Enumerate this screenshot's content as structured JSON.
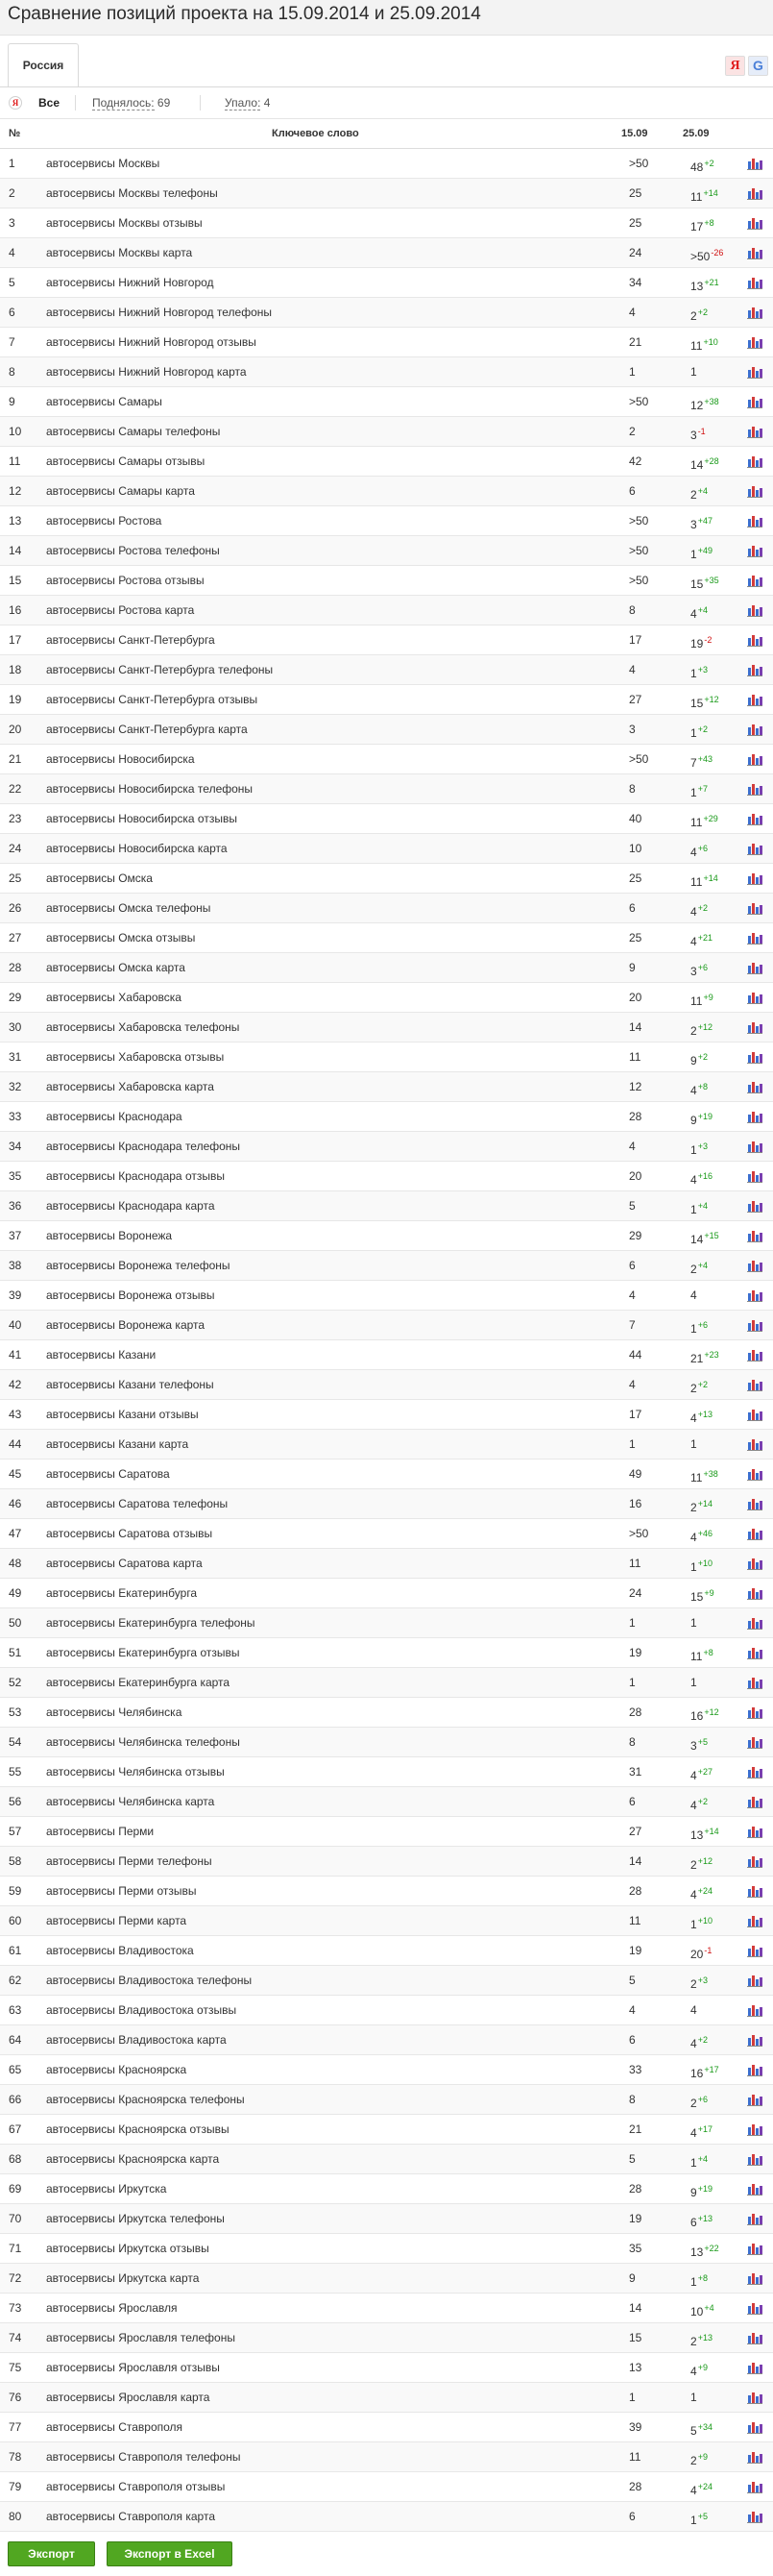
{
  "page": {
    "title": "Сравнение позиций проекта на 15.09.2014 и 25.09.2014"
  },
  "tabs": [
    {
      "label": "Россия"
    }
  ],
  "engines": {
    "yandex": "Я",
    "google": "G"
  },
  "filters": {
    "all": "Все",
    "up_label": "Поднялось:",
    "up_count": "69",
    "down_label": "Упало:",
    "down_count": "4"
  },
  "table": {
    "headers": {
      "no": "№",
      "keyword": "Ключевое слово",
      "date1": "15.09",
      "date2": "25.09"
    },
    "rows": [
      {
        "no": "1",
        "keyword": "автосервисы Москвы",
        "d1": ">50",
        "d2": "48",
        "change": "+2"
      },
      {
        "no": "2",
        "keyword": "автосервисы Москвы телефоны",
        "d1": "25",
        "d2": "11",
        "change": "+14"
      },
      {
        "no": "3",
        "keyword": "автосервисы Москвы отзывы",
        "d1": "25",
        "d2": "17",
        "change": "+8"
      },
      {
        "no": "4",
        "keyword": "автосервисы Москвы карта",
        "d1": "24",
        "d2": ">50",
        "change": "-26"
      },
      {
        "no": "5",
        "keyword": "автосервисы Нижний Новгород",
        "d1": "34",
        "d2": "13",
        "change": "+21"
      },
      {
        "no": "6",
        "keyword": "автосервисы Нижний Новгород телефоны",
        "d1": "4",
        "d2": "2",
        "change": "+2"
      },
      {
        "no": "7",
        "keyword": "автосервисы Нижний Новгород отзывы",
        "d1": "21",
        "d2": "11",
        "change": "+10"
      },
      {
        "no": "8",
        "keyword": "автосервисы Нижний Новгород карта",
        "d1": "1",
        "d2": "1",
        "change": ""
      },
      {
        "no": "9",
        "keyword": "автосервисы Самары",
        "d1": ">50",
        "d2": "12",
        "change": "+38"
      },
      {
        "no": "10",
        "keyword": "автосервисы Самары телефоны",
        "d1": "2",
        "d2": "3",
        "change": "-1"
      },
      {
        "no": "11",
        "keyword": "автосервисы Самары отзывы",
        "d1": "42",
        "d2": "14",
        "change": "+28"
      },
      {
        "no": "12",
        "keyword": "автосервисы Самары карта",
        "d1": "6",
        "d2": "2",
        "change": "+4"
      },
      {
        "no": "13",
        "keyword": "автосервисы Ростова",
        "d1": ">50",
        "d2": "3",
        "change": "+47"
      },
      {
        "no": "14",
        "keyword": "автосервисы Ростова телефоны",
        "d1": ">50",
        "d2": "1",
        "change": "+49"
      },
      {
        "no": "15",
        "keyword": "автосервисы Ростова отзывы",
        "d1": ">50",
        "d2": "15",
        "change": "+35"
      },
      {
        "no": "16",
        "keyword": "автосервисы Ростова карта",
        "d1": "8",
        "d2": "4",
        "change": "+4"
      },
      {
        "no": "17",
        "keyword": "автосервисы Санкт-Петербурга",
        "d1": "17",
        "d2": "19",
        "change": "-2"
      },
      {
        "no": "18",
        "keyword": "автосервисы Санкт-Петербурга телефоны",
        "d1": "4",
        "d2": "1",
        "change": "+3"
      },
      {
        "no": "19",
        "keyword": "автосервисы Санкт-Петербурга отзывы",
        "d1": "27",
        "d2": "15",
        "change": "+12"
      },
      {
        "no": "20",
        "keyword": "автосервисы Санкт-Петербурга карта",
        "d1": "3",
        "d2": "1",
        "change": "+2"
      },
      {
        "no": "21",
        "keyword": "автосервисы Новосибирска",
        "d1": ">50",
        "d2": "7",
        "change": "+43"
      },
      {
        "no": "22",
        "keyword": "автосервисы Новосибирска телефоны",
        "d1": "8",
        "d2": "1",
        "change": "+7"
      },
      {
        "no": "23",
        "keyword": "автосервисы Новосибирска отзывы",
        "d1": "40",
        "d2": "11",
        "change": "+29"
      },
      {
        "no": "24",
        "keyword": "автосервисы Новосибирска карта",
        "d1": "10",
        "d2": "4",
        "change": "+6"
      },
      {
        "no": "25",
        "keyword": "автосервисы Омска",
        "d1": "25",
        "d2": "11",
        "change": "+14"
      },
      {
        "no": "26",
        "keyword": "автосервисы Омска телефоны",
        "d1": "6",
        "d2": "4",
        "change": "+2"
      },
      {
        "no": "27",
        "keyword": "автосервисы Омска отзывы",
        "d1": "25",
        "d2": "4",
        "change": "+21"
      },
      {
        "no": "28",
        "keyword": "автосервисы Омска карта",
        "d1": "9",
        "d2": "3",
        "change": "+6"
      },
      {
        "no": "29",
        "keyword": "автосервисы Хабаровска",
        "d1": "20",
        "d2": "11",
        "change": "+9"
      },
      {
        "no": "30",
        "keyword": "автосервисы Хабаровска телефоны",
        "d1": "14",
        "d2": "2",
        "change": "+12"
      },
      {
        "no": "31",
        "keyword": "автосервисы Хабаровска отзывы",
        "d1": "11",
        "d2": "9",
        "change": "+2"
      },
      {
        "no": "32",
        "keyword": "автосервисы Хабаровска карта",
        "d1": "12",
        "d2": "4",
        "change": "+8"
      },
      {
        "no": "33",
        "keyword": "автосервисы Краснодара",
        "d1": "28",
        "d2": "9",
        "change": "+19"
      },
      {
        "no": "34",
        "keyword": "автосервисы Краснодара телефоны",
        "d1": "4",
        "d2": "1",
        "change": "+3"
      },
      {
        "no": "35",
        "keyword": "автосервисы Краснодара отзывы",
        "d1": "20",
        "d2": "4",
        "change": "+16"
      },
      {
        "no": "36",
        "keyword": "автосервисы Краснодара карта",
        "d1": "5",
        "d2": "1",
        "change": "+4"
      },
      {
        "no": "37",
        "keyword": "автосервисы Воронежа",
        "d1": "29",
        "d2": "14",
        "change": "+15"
      },
      {
        "no": "38",
        "keyword": "автосервисы Воронежа телефоны",
        "d1": "6",
        "d2": "2",
        "change": "+4"
      },
      {
        "no": "39",
        "keyword": "автосервисы Воронежа отзывы",
        "d1": "4",
        "d2": "4",
        "change": ""
      },
      {
        "no": "40",
        "keyword": "автосервисы Воронежа карта",
        "d1": "7",
        "d2": "1",
        "change": "+6"
      },
      {
        "no": "41",
        "keyword": "автосервисы Казани",
        "d1": "44",
        "d2": "21",
        "change": "+23"
      },
      {
        "no": "42",
        "keyword": "автосервисы Казани телефоны",
        "d1": "4",
        "d2": "2",
        "change": "+2"
      },
      {
        "no": "43",
        "keyword": "автосервисы Казани отзывы",
        "d1": "17",
        "d2": "4",
        "change": "+13"
      },
      {
        "no": "44",
        "keyword": "автосервисы Казани карта",
        "d1": "1",
        "d2": "1",
        "change": ""
      },
      {
        "no": "45",
        "keyword": "автосервисы Саратова",
        "d1": "49",
        "d2": "11",
        "change": "+38"
      },
      {
        "no": "46",
        "keyword": "автосервисы Саратова телефоны",
        "d1": "16",
        "d2": "2",
        "change": "+14"
      },
      {
        "no": "47",
        "keyword": "автосервисы Саратова отзывы",
        "d1": ">50",
        "d2": "4",
        "change": "+46"
      },
      {
        "no": "48",
        "keyword": "автосервисы Саратова карта",
        "d1": "11",
        "d2": "1",
        "change": "+10"
      },
      {
        "no": "49",
        "keyword": "автосервисы Екатеринбурга",
        "d1": "24",
        "d2": "15",
        "change": "+9"
      },
      {
        "no": "50",
        "keyword": "автосервисы Екатеринбурга телефоны",
        "d1": "1",
        "d2": "1",
        "change": ""
      },
      {
        "no": "51",
        "keyword": "автосервисы Екатеринбурга отзывы",
        "d1": "19",
        "d2": "11",
        "change": "+8"
      },
      {
        "no": "52",
        "keyword": "автосервисы Екатеринбурга карта",
        "d1": "1",
        "d2": "1",
        "change": ""
      },
      {
        "no": "53",
        "keyword": "автосервисы Челябинска",
        "d1": "28",
        "d2": "16",
        "change": "+12"
      },
      {
        "no": "54",
        "keyword": "автосервисы Челябинска телефоны",
        "d1": "8",
        "d2": "3",
        "change": "+5"
      },
      {
        "no": "55",
        "keyword": "автосервисы Челябинска отзывы",
        "d1": "31",
        "d2": "4",
        "change": "+27"
      },
      {
        "no": "56",
        "keyword": "автосервисы Челябинска карта",
        "d1": "6",
        "d2": "4",
        "change": "+2"
      },
      {
        "no": "57",
        "keyword": "автосервисы Перми",
        "d1": "27",
        "d2": "13",
        "change": "+14"
      },
      {
        "no": "58",
        "keyword": "автосервисы Перми телефоны",
        "d1": "14",
        "d2": "2",
        "change": "+12"
      },
      {
        "no": "59",
        "keyword": "автосервисы Перми отзывы",
        "d1": "28",
        "d2": "4",
        "change": "+24"
      },
      {
        "no": "60",
        "keyword": "автосервисы Перми карта",
        "d1": "11",
        "d2": "1",
        "change": "+10"
      },
      {
        "no": "61",
        "keyword": "автосервисы Владивостока",
        "d1": "19",
        "d2": "20",
        "change": "-1"
      },
      {
        "no": "62",
        "keyword": "автосервисы Владивостока телефоны",
        "d1": "5",
        "d2": "2",
        "change": "+3"
      },
      {
        "no": "63",
        "keyword": "автосервисы Владивостока отзывы",
        "d1": "4",
        "d2": "4",
        "change": ""
      },
      {
        "no": "64",
        "keyword": "автосервисы Владивостока карта",
        "d1": "6",
        "d2": "4",
        "change": "+2"
      },
      {
        "no": "65",
        "keyword": "автосервисы Красноярска",
        "d1": "33",
        "d2": "16",
        "change": "+17"
      },
      {
        "no": "66",
        "keyword": "автосервисы Красноярска телефоны",
        "d1": "8",
        "d2": "2",
        "change": "+6"
      },
      {
        "no": "67",
        "keyword": "автосервисы Красноярска отзывы",
        "d1": "21",
        "d2": "4",
        "change": "+17"
      },
      {
        "no": "68",
        "keyword": "автосервисы Красноярска карта",
        "d1": "5",
        "d2": "1",
        "change": "+4"
      },
      {
        "no": "69",
        "keyword": "автосервисы Иркутска",
        "d1": "28",
        "d2": "9",
        "change": "+19"
      },
      {
        "no": "70",
        "keyword": "автосервисы Иркутска телефоны",
        "d1": "19",
        "d2": "6",
        "change": "+13"
      },
      {
        "no": "71",
        "keyword": "автосервисы Иркутска отзывы",
        "d1": "35",
        "d2": "13",
        "change": "+22"
      },
      {
        "no": "72",
        "keyword": "автосервисы Иркутска карта",
        "d1": "9",
        "d2": "1",
        "change": "+8"
      },
      {
        "no": "73",
        "keyword": "автосервисы Ярославля",
        "d1": "14",
        "d2": "10",
        "change": "+4"
      },
      {
        "no": "74",
        "keyword": "автосервисы Ярославля телефоны",
        "d1": "15",
        "d2": "2",
        "change": "+13"
      },
      {
        "no": "75",
        "keyword": "автосервисы Ярославля отзывы",
        "d1": "13",
        "d2": "4",
        "change": "+9"
      },
      {
        "no": "76",
        "keyword": "автосервисы Ярославля карта",
        "d1": "1",
        "d2": "1",
        "change": ""
      },
      {
        "no": "77",
        "keyword": "автосервисы Ставрополя",
        "d1": "39",
        "d2": "5",
        "change": "+34"
      },
      {
        "no": "78",
        "keyword": "автосервисы Ставрополя телефоны",
        "d1": "11",
        "d2": "2",
        "change": "+9"
      },
      {
        "no": "79",
        "keyword": "автосервисы Ставрополя отзывы",
        "d1": "28",
        "d2": "4",
        "change": "+24"
      },
      {
        "no": "80",
        "keyword": "автосервисы Ставрополя карта",
        "d1": "6",
        "d2": "1",
        "change": "+5"
      }
    ]
  },
  "buttons": {
    "export": "Экспорт",
    "export_excel": "Экспорт в Excel"
  },
  "colors": {
    "up": "#1a9a1a",
    "down": "#d01010",
    "button": "#51a721"
  },
  "icons": {
    "row_chart": "bar-chart-icon"
  }
}
